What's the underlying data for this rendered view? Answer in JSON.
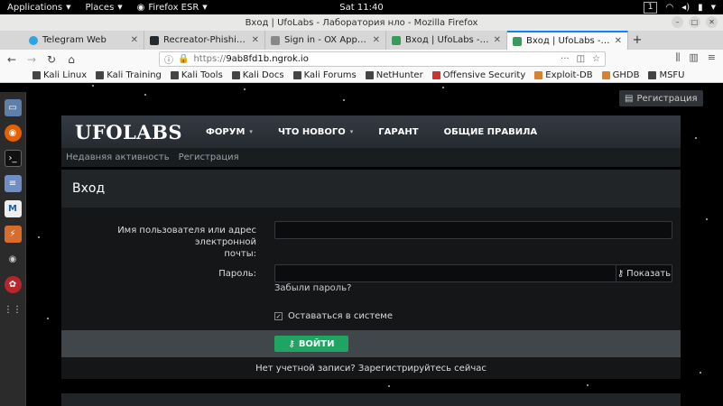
{
  "topbar": {
    "applications": "Applications",
    "places": "Places",
    "firefox": "Firefox ESR",
    "clock": "Sat 11:40",
    "workspace": "1"
  },
  "window": {
    "title": "Вход | UfoLabs - Лаборатория нло - Mozilla Firefox"
  },
  "tabs": [
    {
      "label": "Telegram Web",
      "color": "#2ca5e0"
    },
    {
      "label": "Recreator-Phishing:Ути",
      "color": "#24292e"
    },
    {
      "label": "Sign in - OX App Suite",
      "color": "#888888"
    },
    {
      "label": "Вход | UfoLabs - Лабора",
      "color": "#3a9a5c"
    },
    {
      "label": "Вход | UfoLabs - Лабора",
      "color": "#3a9a5c"
    }
  ],
  "url": {
    "scheme": "https://",
    "host": "9ab8fd1b.ngrok.io"
  },
  "bookmarks": [
    "Kali Linux",
    "Kali Training",
    "Kali Tools",
    "Kali Docs",
    "Kali Forums",
    "NetHunter",
    "Offensive Security",
    "Exploit-DB",
    "GHDB",
    "MSFU"
  ],
  "site": {
    "register_top": "Регистрация",
    "logo": "UFOLABS",
    "nav": [
      {
        "label": "ФОРУМ",
        "caret": "▾"
      },
      {
        "label": "ЧТО НОВОГО",
        "caret": "▾"
      },
      {
        "label": "ГАРАНТ",
        "caret": ""
      },
      {
        "label": "ОБЩИЕ ПРАВИЛА",
        "caret": ""
      }
    ],
    "subnav": [
      "Недавняя активность",
      "Регистрация"
    ],
    "page_title": "Вход",
    "form": {
      "username_label_1": "Имя пользователя или адрес электронной",
      "username_label_2": "почты:",
      "username_value": "",
      "password_label": "Пароль:",
      "password_value": "",
      "show_password": "Показать",
      "forgot": "Забыли пароль?",
      "remember": "Оставаться в системе",
      "submit": "ВОЙТИ"
    },
    "signup": "Нет учетной записи? Зарегистрируйтесь сейчас"
  }
}
